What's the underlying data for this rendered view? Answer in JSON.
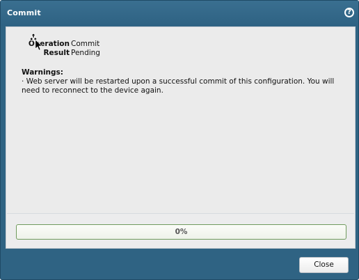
{
  "dialog": {
    "title": "Commit",
    "help_icon": "help-icon",
    "help_glyph": "?"
  },
  "details": {
    "operation_label": "Operation",
    "operation_value": "Commit",
    "result_label": "Result",
    "result_value": "Pending"
  },
  "warnings": {
    "title": "Warnings:",
    "items": [
      "· Web server will be restarted upon a successful commit of this configuration. You will need to reconnect to the device again."
    ]
  },
  "progress": {
    "percent": 0,
    "label": "0%"
  },
  "footer": {
    "close_label": "Close"
  },
  "colors": {
    "titlebar": "#2f6383",
    "panel": "#ececed",
    "progress_border": "#6f9a5d"
  }
}
